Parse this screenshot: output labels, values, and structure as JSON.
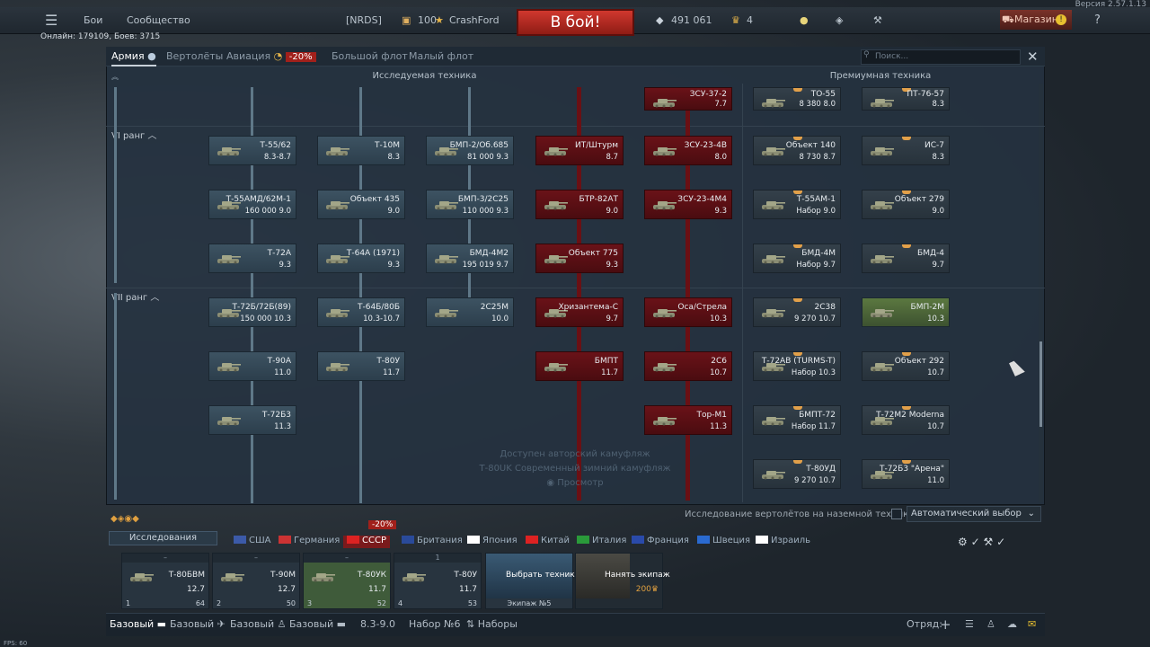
{
  "top_bar": {
    "menu_icon": "hamburger-icon",
    "battles": "Бои",
    "community": "Сообщество",
    "squad_tag": "[NRDS]",
    "level": "100",
    "player": "CrashFord",
    "battle_button": "В бой!",
    "silver": "491 061",
    "gold": "4",
    "shop": "Магазин",
    "help_icon": "?"
  },
  "version": "Версия 2.57.1.13",
  "online": "Онлайн: 179109, Боев: 3715",
  "tabs": {
    "army": "Армия",
    "helicopters": "Вертолёты",
    "aviation": "Авиация",
    "discount": "-20%",
    "bluewater": "Большой флот",
    "coastal": "Малый флот"
  },
  "search_placeholder": "Поиск...",
  "headers": {
    "researched": "Исследуемая техника",
    "premium": "Премиумная техника"
  },
  "ranks": {
    "r6": "VI ранг",
    "r7": "VII ранг"
  },
  "vehicles": [
    {
      "id": "t5562",
      "name": "Т-55/62",
      "br": "8.3-8.7",
      "kind": "tree"
    },
    {
      "id": "t10m",
      "name": "Т-10М",
      "br": "8.3",
      "kind": "tree"
    },
    {
      "id": "bmp2",
      "name": "БМП-2/Об.685",
      "br": "81 000 9.3",
      "kind": "tree"
    },
    {
      "id": "it",
      "name": "ИТ/Штурм",
      "br": "8.7",
      "kind": "red"
    },
    {
      "id": "zsu234v",
      "name": "ЗСУ-23-4В",
      "br": "8.0",
      "kind": "red"
    },
    {
      "id": "zsu372",
      "name": "ЗСУ-37-2",
      "br": "7.7",
      "kind": "red"
    },
    {
      "id": "to55",
      "name": "ТО-55",
      "br": "8 380 8.0",
      "kind": "prem"
    },
    {
      "id": "pt7657",
      "name": "ПТ-76-57",
      "br": "8.3",
      "kind": "prem"
    },
    {
      "id": "ob140",
      "name": "Объект 140",
      "br": "8 730 8.7",
      "kind": "prem"
    },
    {
      "id": "is7",
      "name": "ИС-7",
      "br": "8.3",
      "kind": "prem"
    },
    {
      "id": "t55amd",
      "name": "Т-55АМД/62М-1",
      "br": "160 000 9.0",
      "kind": "tree"
    },
    {
      "id": "ob435",
      "name": "Объект 435",
      "br": "9.0",
      "kind": "tree"
    },
    {
      "id": "bmp3",
      "name": "БМП-3/2С25",
      "br": "110 000 9.3",
      "kind": "tree"
    },
    {
      "id": "btr82",
      "name": "БТР-82АТ",
      "br": "9.0",
      "kind": "red"
    },
    {
      "id": "zsu234m4",
      "name": "ЗСУ-23-4М4",
      "br": "9.3",
      "kind": "red"
    },
    {
      "id": "t55am1",
      "name": "Т-55АМ-1",
      "br": "Набор 9.0",
      "kind": "prem"
    },
    {
      "id": "ob279",
      "name": "Объект 279",
      "br": "9.0",
      "kind": "prem"
    },
    {
      "id": "t72a",
      "name": "Т-72А",
      "br": "9.3",
      "kind": "tree"
    },
    {
      "id": "t64a",
      "name": "Т-64А (1971)",
      "br": "9.3",
      "kind": "tree"
    },
    {
      "id": "bmd4m2",
      "name": "БМД-4М2",
      "br": "195 019 9.7",
      "kind": "tree"
    },
    {
      "id": "ob775",
      "name": "Объект 775",
      "br": "9.3",
      "kind": "red"
    },
    {
      "id": "bmd4m",
      "name": "БМД-4М",
      "br": "Набор 9.7",
      "kind": "prem"
    },
    {
      "id": "bmd4",
      "name": "БМД-4",
      "br": "9.7",
      "kind": "prem"
    },
    {
      "id": "t72b",
      "name": "Т-72Б/72Б(89)",
      "br": "150 000 10.3",
      "kind": "tree"
    },
    {
      "id": "t64b",
      "name": "Т-64Б/80Б",
      "br": "10.3-10.7",
      "kind": "tree"
    },
    {
      "id": "2s25m",
      "name": "2С25М",
      "br": "10.0",
      "kind": "tree"
    },
    {
      "id": "khriz",
      "name": "Хризантема-С",
      "br": "9.7",
      "kind": "red"
    },
    {
      "id": "osa",
      "name": "Оса/Стрела",
      "br": "10.3",
      "kind": "red"
    },
    {
      "id": "2s38",
      "name": "2С38",
      "br": "9 270 10.7",
      "kind": "prem"
    },
    {
      "id": "bmp2m",
      "name": "БМП-2М",
      "br": "10.3",
      "kind": "own"
    },
    {
      "id": "t90a",
      "name": "Т-90А",
      "br": "11.0",
      "kind": "tree"
    },
    {
      "id": "t80u",
      "name": "Т-80У",
      "br": "11.7",
      "kind": "tree"
    },
    {
      "id": "bmpt",
      "name": "БМПТ",
      "br": "11.7",
      "kind": "red"
    },
    {
      "id": "2s6",
      "name": "2С6",
      "br": "10.7",
      "kind": "red"
    },
    {
      "id": "t72av",
      "name": "Т-72АВ (TURMS-T)",
      "br": "Набор 10.3",
      "kind": "prem"
    },
    {
      "id": "ob292",
      "name": "Объект 292",
      "br": "10.7",
      "kind": "prem"
    },
    {
      "id": "t72b3",
      "name": "Т-72Б3",
      "br": "11.3",
      "kind": "tree"
    },
    {
      "id": "torm1",
      "name": "Тор-М1",
      "br": "11.3",
      "kind": "red"
    },
    {
      "id": "bmpt72",
      "name": "БМПТ-72",
      "br": "Набор 11.7",
      "kind": "prem"
    },
    {
      "id": "t72m2",
      "name": "Т-72М2 Moderna",
      "br": "10.7",
      "kind": "prem"
    },
    {
      "id": "t80ud",
      "name": "Т-80УД",
      "br": "9 270 10.7",
      "kind": "prem"
    },
    {
      "id": "t72b3a",
      "name": "Т-72Б3 \"Арена\"",
      "br": "11.0",
      "kind": "prem"
    }
  ],
  "camo": {
    "line1": "Доступен авторский камуфляж",
    "line2": "Т-80UK Современный зимний камуфляж",
    "line3": "Просмотр"
  },
  "helicopter_research": "Исследование вертолётов на наземной технике",
  "auto_select": "Автоматический выбор",
  "research_button": "Исследования",
  "nations": [
    "США",
    "Германия",
    "СССР",
    "Британия",
    "Япония",
    "Китай",
    "Италия",
    "Франция",
    "Швеция",
    "Израиль"
  ],
  "nation_discount": "-20%",
  "crew": [
    {
      "name": "Т-80БВМ",
      "br": "12.7",
      "slot": "1",
      "count": "64",
      "top": "–"
    },
    {
      "name": "Т-90М",
      "br": "12.7",
      "slot": "2",
      "count": "50",
      "top": "–"
    },
    {
      "name": "Т-80УК",
      "br": "11.7",
      "slot": "3",
      "count": "52",
      "top": "–"
    },
    {
      "name": "Т-80У",
      "br": "11.7",
      "slot": "4",
      "count": "53",
      "top": "1"
    }
  ],
  "choose_vehicle": "Выбрать технику",
  "crew_no": "Экипаж №5",
  "hire_crew": "Нанять экипаж",
  "hire_cost": "200",
  "bottom": {
    "b1": "Базовый",
    "b2": "Базовый",
    "b3": "Базовый",
    "b4": "Базовый",
    "br_range": "8.3-9.0",
    "preset": "Набор №6",
    "presets": "Наборы",
    "squad": "Отряд:"
  },
  "fps": "FPS: 60",
  "colors": {
    "battle_red": "#c0342a",
    "accent_blue": "#3d5362",
    "red_branch": "#6a1218"
  }
}
